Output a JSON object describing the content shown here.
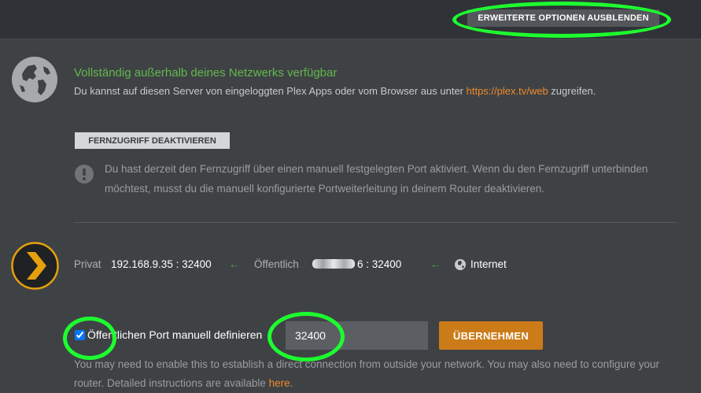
{
  "header": {
    "hide_advanced_label": "ERWEITERTE OPTIONEN AUSBLENDEN"
  },
  "availability": {
    "title": "Vollständig außerhalb deines Netzwerks verfügbar",
    "desc_before": "Du kannst auf diesen Server von eingeloggten Plex Apps oder vom Browser aus unter ",
    "link": "https://plex.tv/web",
    "desc_after": " zugreifen."
  },
  "remote": {
    "disable_label": "FERNZUGRIFF DEAKTIVIEREN",
    "warning": "Du hast derzeit den Fernzugriff über einen manuell festgelegten Port aktiviert. Wenn du den Fernzugriff unterbinden möchtest, musst du die manuell konfigurierte Portweiterleitung in deinem Router deaktivieren."
  },
  "connection": {
    "private_label": "Privat",
    "private_address": "192.168.9.35 : 32400",
    "public_label": "Öffentlich",
    "public_address_tail": "6 : 32400",
    "internet_label": "Internet",
    "arrow_glyph": "←"
  },
  "port": {
    "checkbox_label": "Öffentlichen Port manuell definieren",
    "checked": true,
    "value": "32400",
    "apply_label": "ÜBERNEHMEN",
    "help_before": "You may need to enable this to establish a direct connection from outside your network. You may also need to configure your router. Detailed instructions are available ",
    "help_link": "here",
    "help_after": "."
  },
  "colors": {
    "success": "#62b84c",
    "link": "#f0892c",
    "accent_button": "#cc7b19",
    "checkbox": "#2f7df1",
    "highlight": "#1dff2f",
    "plex_chevron": "#e5a00d"
  },
  "icons": {
    "availability": "globe-icon",
    "warning": "exclamation-circle-icon",
    "server": "plex-logo-icon",
    "internet": "globe-small-icon",
    "arrows": "arrow-left-icon"
  }
}
